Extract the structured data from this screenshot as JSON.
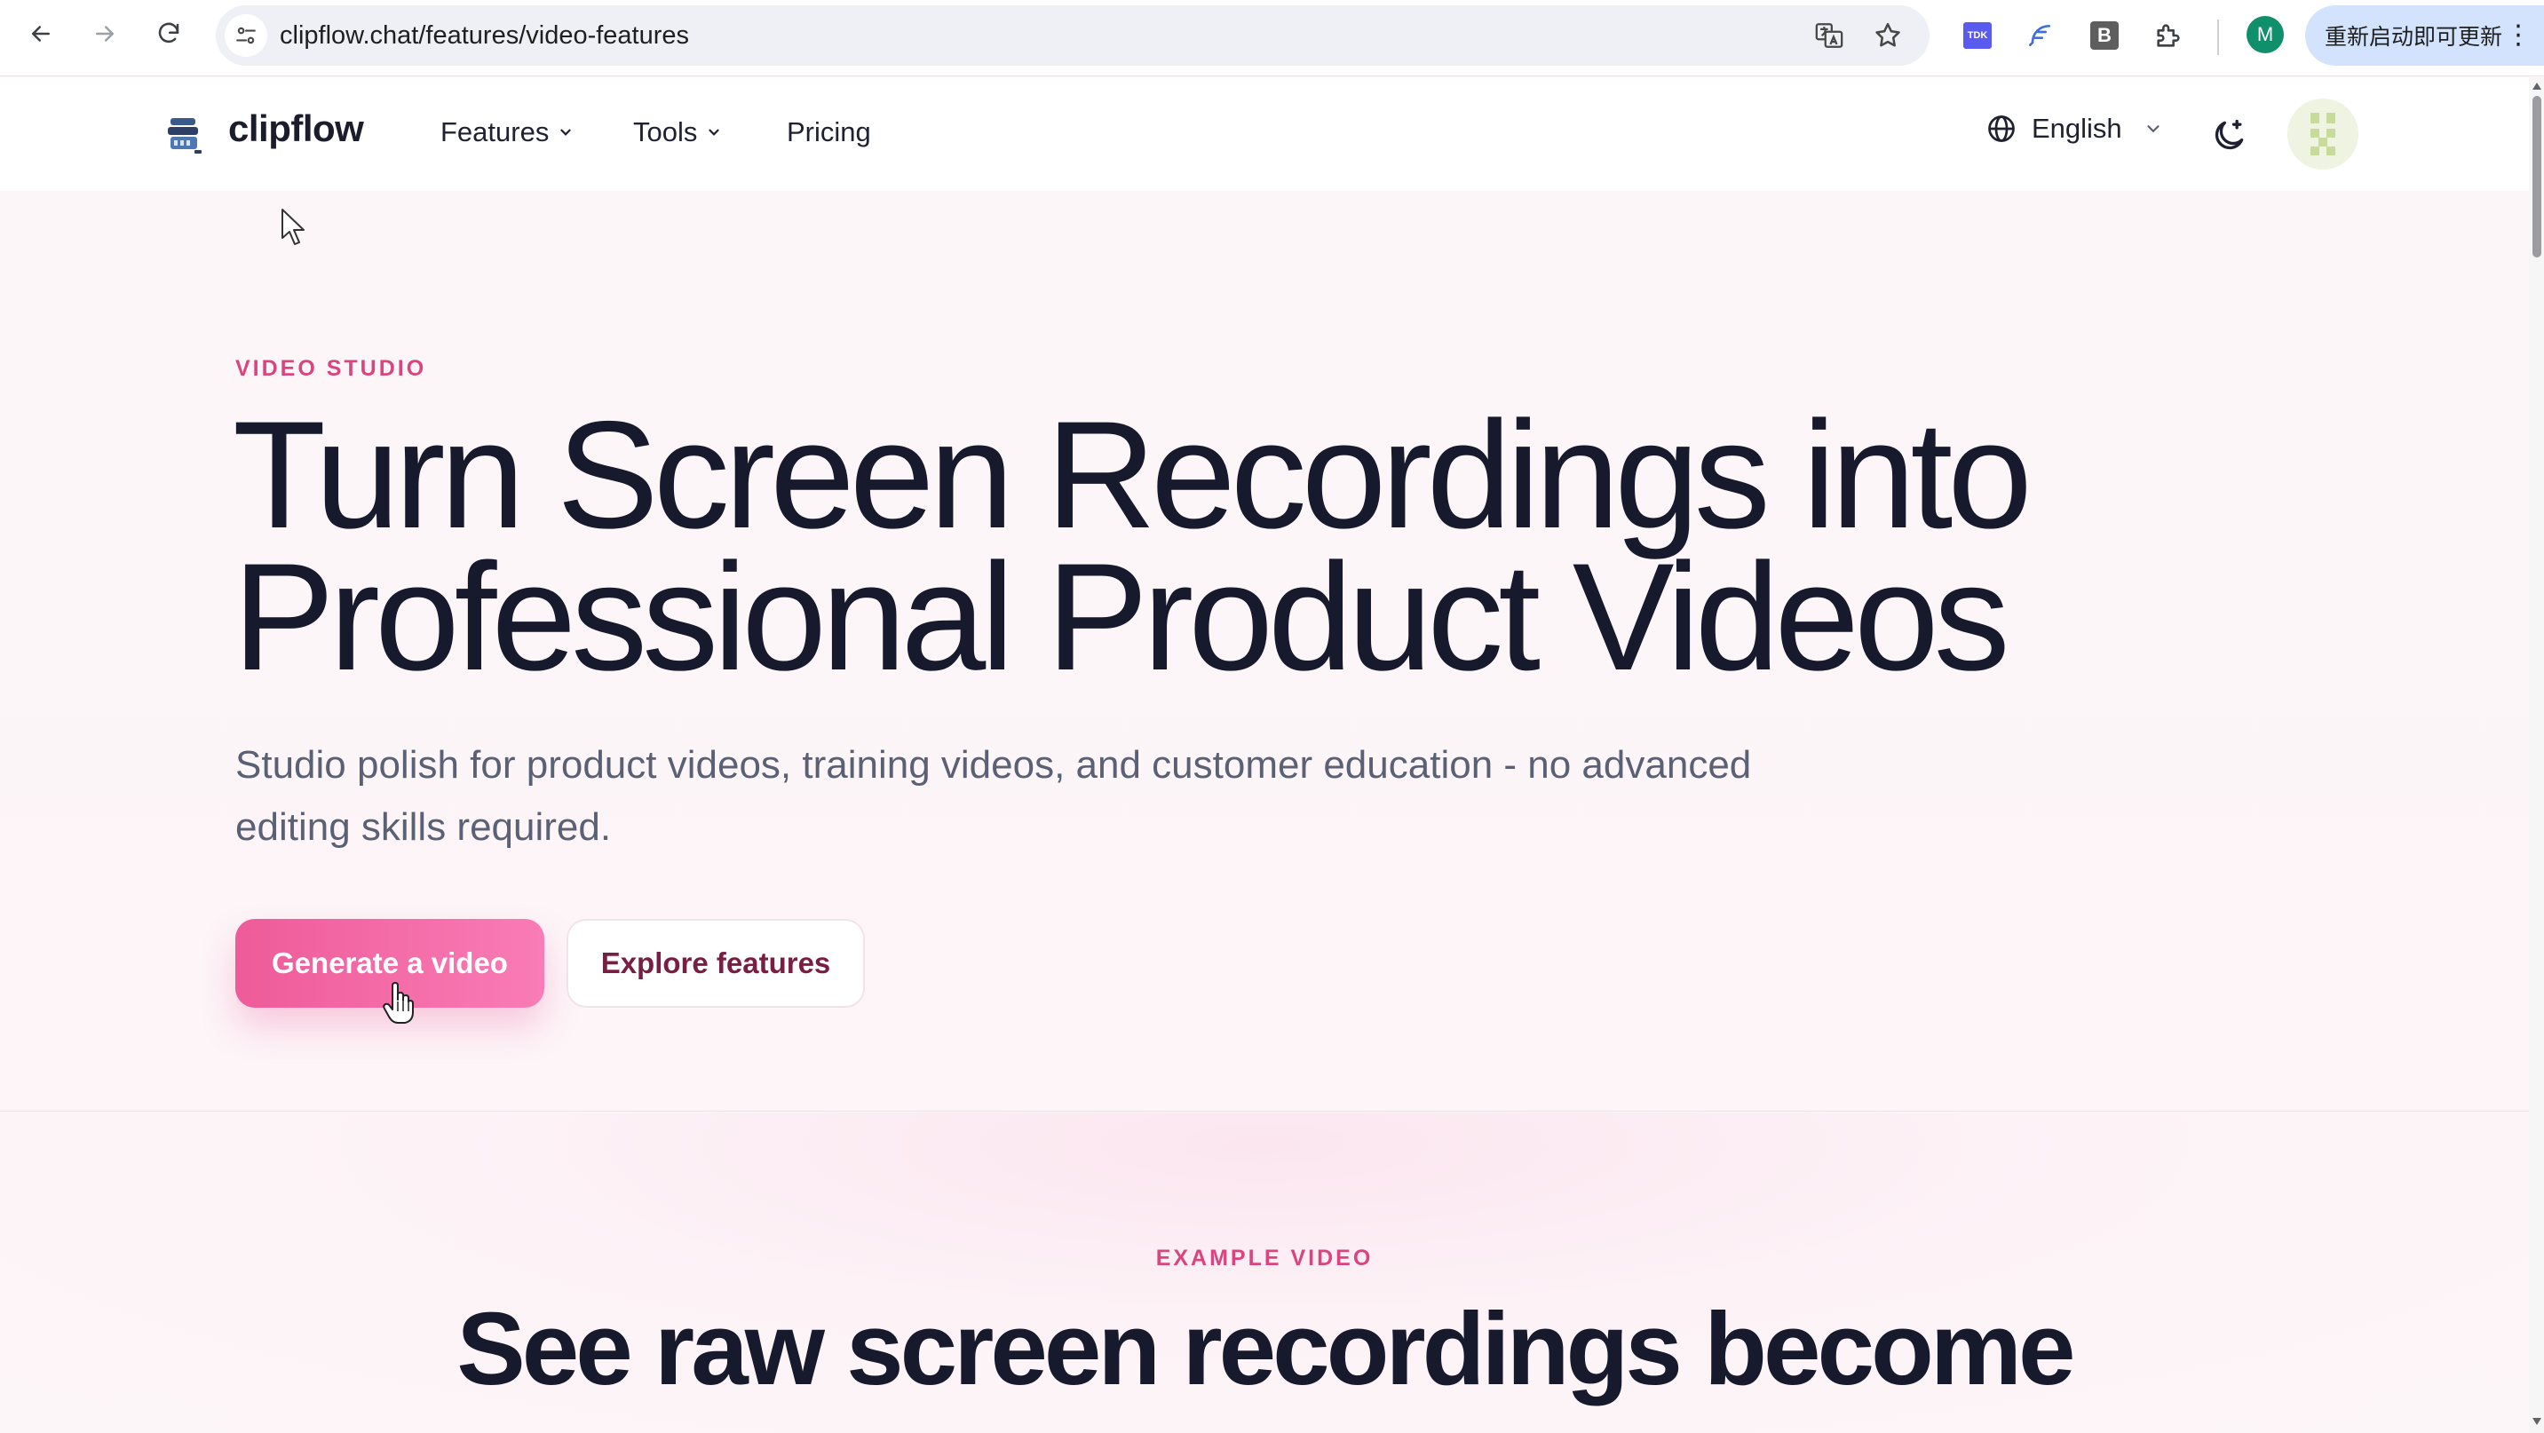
{
  "browser": {
    "url": "clipflow.chat/features/video-features",
    "profile_initial": "M",
    "update_label": "重新启动即可更新",
    "extension_tdk_label": "TDK",
    "extension_b_label": "B",
    "menu_glyph": "⋮"
  },
  "header": {
    "logo_text": "clipflow",
    "nav": {
      "features": "Features",
      "tools": "Tools",
      "pricing": "Pricing"
    },
    "language": "English"
  },
  "hero": {
    "eyebrow": "VIDEO STUDIO",
    "title_line1": "Turn Screen Recordings into",
    "title_line2": "Professional Product Videos",
    "subtitle": "Studio polish for product videos, training videos, and customer education - no advanced editing skills required.",
    "primary_cta": "Generate a video",
    "secondary_cta": "Explore features"
  },
  "example": {
    "eyebrow": "EXAMPLE VIDEO",
    "title": "See raw screen recordings become"
  },
  "colors": {
    "accent": "#d9467f",
    "cta_gradient_start": "#ee5b99",
    "cta_gradient_end": "#f97cb6",
    "secondary_text": "#7a1d45",
    "heading": "#171a2c"
  },
  "icons": [
    "back-icon",
    "forward-icon",
    "reload-icon",
    "site-info-icon",
    "translate-icon",
    "star-icon",
    "puzzle-icon",
    "globe-icon",
    "moon-icon",
    "chevron-down-icon"
  ]
}
